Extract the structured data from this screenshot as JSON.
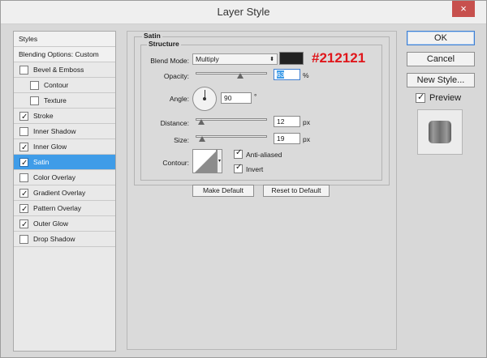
{
  "window": {
    "title": "Layer Style",
    "close_icon": "×"
  },
  "styles_list": {
    "header": "Styles",
    "blending_options": "Blending Options: Custom",
    "items": [
      {
        "label": "Bevel & Emboss",
        "checked": false
      },
      {
        "label": "Contour",
        "checked": false
      },
      {
        "label": "Texture",
        "checked": false
      },
      {
        "label": "Stroke",
        "checked": true
      },
      {
        "label": "Inner Shadow",
        "checked": false
      },
      {
        "label": "Inner Glow",
        "checked": true
      },
      {
        "label": "Satin",
        "checked": true,
        "selected": true
      },
      {
        "label": "Color Overlay",
        "checked": false
      },
      {
        "label": "Gradient Overlay",
        "checked": true
      },
      {
        "label": "Pattern Overlay",
        "checked": true
      },
      {
        "label": "Outer Glow",
        "checked": true
      },
      {
        "label": "Drop Shadow",
        "checked": false
      }
    ]
  },
  "satin": {
    "section_title": "Satin",
    "group_title": "Structure",
    "blend_mode_label": "Blend Mode:",
    "blend_mode_value": "Multiply",
    "color": "#212121",
    "color_callout": "#212121",
    "opacity_label": "Opacity:",
    "opacity_value": "63",
    "opacity_unit": "%",
    "angle_label": "Angle:",
    "angle_value": "90",
    "angle_unit": "°",
    "distance_label": "Distance:",
    "distance_value": "12",
    "distance_unit": "px",
    "size_label": "Size:",
    "size_value": "19",
    "size_unit": "px",
    "contour_label": "Contour:",
    "anti_aliased_label": "Anti-aliased",
    "anti_aliased_checked": true,
    "invert_label": "Invert",
    "invert_checked": true,
    "make_default_label": "Make Default",
    "reset_default_label": "Reset to Default"
  },
  "buttons": {
    "ok": "OK",
    "cancel": "Cancel",
    "new_style": "New Style...",
    "preview_label": "Preview",
    "preview_checked": true
  },
  "colors": {
    "selection": "#3f9ce8",
    "callout": "#e0161b",
    "close": "#c7504d"
  }
}
